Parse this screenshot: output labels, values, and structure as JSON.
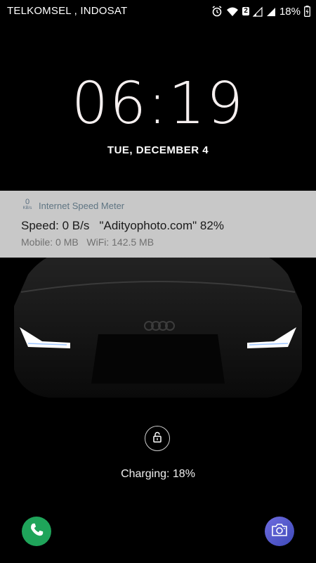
{
  "status_bar": {
    "carrier": "TELKOMSEL , INDOSAT",
    "sim_badge": "2",
    "battery_percent": "18%",
    "icons": [
      "alarm-icon",
      "wifi-icon",
      "sim2-icon",
      "signal-icon",
      "signal-icon",
      "battery-charging-icon"
    ]
  },
  "lockscreen": {
    "time": "06:19",
    "date": "TUE, DECEMBER 4",
    "charging": "Charging: 18%"
  },
  "notification": {
    "icon_value": "0",
    "icon_unit": "KB/s",
    "app_name": "Internet Speed Meter",
    "title": "Speed: 0 B/s   \"Adityophoto.com\" 82%",
    "subtitle": "Mobile: 0 MB   WiFi: 142.5 MB"
  },
  "shortcuts": {
    "left": "phone-icon",
    "right": "camera-icon"
  },
  "colors": {
    "background": "#000000",
    "notification_bg": "#c8c8c8",
    "phone": "#1fa45a",
    "camera": "#4f57c9"
  }
}
